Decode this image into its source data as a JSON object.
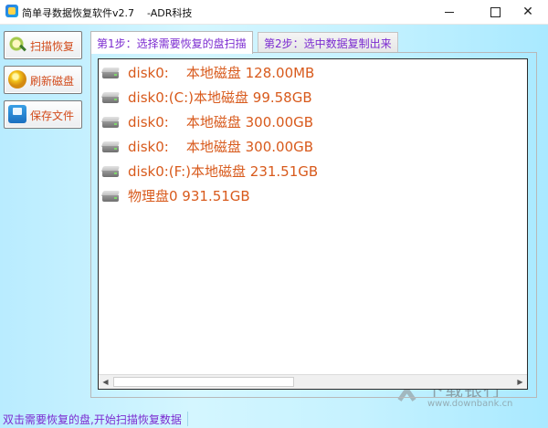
{
  "window": {
    "title": "简单寻数据恢复软件v2.7    -ADR科技"
  },
  "sidebar": {
    "buttons": [
      {
        "label": "扫描恢复",
        "icon": "magnifier-scan-icon"
      },
      {
        "label": "刷新磁盘",
        "icon": "refresh-lightbulb-icon"
      },
      {
        "label": "保存文件",
        "icon": "save-folder-icon"
      }
    ]
  },
  "tabs": [
    {
      "label": "第1步：选择需要恢复的盘扫描",
      "active": true
    },
    {
      "label": "第2步：选中数据复制出来",
      "active": false
    }
  ],
  "disk_list": {
    "items": [
      "disk0:    本地磁盘 128.00MB",
      "disk0:(C:)本地磁盘 99.58GB",
      "disk0:    本地磁盘 300.00GB",
      "disk0:    本地磁盘 300.00GB",
      "disk0:(F:)本地磁盘 231.51GB",
      "物理盘0 931.51GB"
    ],
    "item_icon": "hard-disk-icon"
  },
  "status": {
    "text": "双击需要恢复的盘,开始扫描恢复数据"
  },
  "watermark": {
    "main": "下载银行",
    "sub": "www.downbank.cn"
  },
  "colors": {
    "accent_text": "#d85a1c",
    "tab_text": "#7b2bd0",
    "background": "#c6f2ff"
  }
}
